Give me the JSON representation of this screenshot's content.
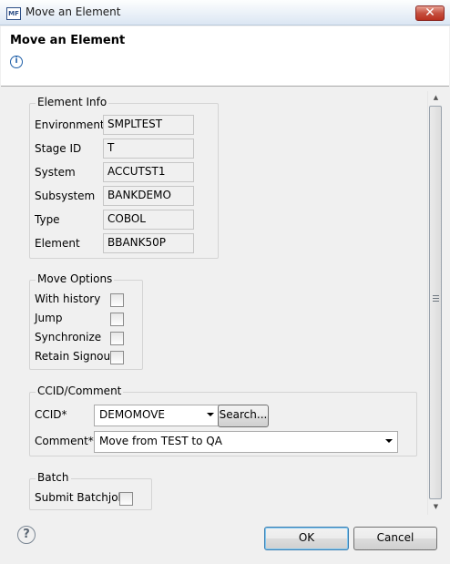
{
  "window": {
    "app_icon_text": "MF",
    "title": "Move an Element",
    "close_glyph": "✕"
  },
  "header": {
    "title": "Move an Element",
    "info_icon": "info-icon"
  },
  "element_info": {
    "title": "Element Info",
    "fields": [
      {
        "label": "Environment",
        "value": "SMPLTEST"
      },
      {
        "label": "Stage ID",
        "value": "T"
      },
      {
        "label": "System",
        "value": "ACCUTST1"
      },
      {
        "label": "Subsystem",
        "value": "BANKDEMO"
      },
      {
        "label": "Type",
        "value": "COBOL"
      },
      {
        "label": "Element",
        "value": "BBANK50P"
      }
    ]
  },
  "move_options": {
    "title": "Move Options",
    "options": [
      {
        "label": "With history",
        "checked": false
      },
      {
        "label": "Jump",
        "checked": false
      },
      {
        "label": "Synchronize",
        "checked": false
      },
      {
        "label": "Retain Signout",
        "checked": false
      }
    ]
  },
  "ccid_comment": {
    "title": "CCID/Comment",
    "ccid_label": "CCID*",
    "ccid_value": "DEMOMOVE",
    "search_button": "Search...",
    "comment_label": "Comment*",
    "comment_value": "Move from TEST to QA"
  },
  "batch": {
    "title": "Batch",
    "submit_label": "Submit Batchjob",
    "checked": false
  },
  "footer": {
    "ok_label": "OK",
    "cancel_label": "Cancel",
    "help_icon": "help-icon"
  }
}
